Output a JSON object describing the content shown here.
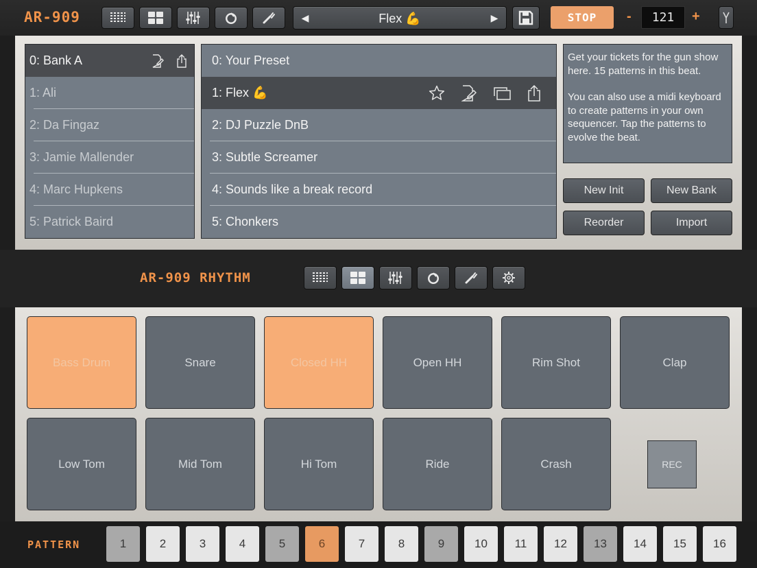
{
  "app": {
    "logo": "AR-909",
    "instrument_logo": "AR-909 RHYTHM",
    "accent_color": "#f0934a"
  },
  "toolbar": {
    "buttons": [
      {
        "icon": "grid-icon"
      },
      {
        "icon": "pads-icon"
      },
      {
        "icon": "mixer-icon"
      },
      {
        "icon": "knob-icon"
      },
      {
        "icon": "wrench-icon"
      }
    ],
    "preset_name": "Flex 💪",
    "prev_symbol": "◀",
    "next_symbol": "▶",
    "stop_label": "STOP",
    "tempo_minus": "-",
    "tempo_value": "121",
    "tempo_plus": "+"
  },
  "banks": [
    {
      "label": "0: Bank A",
      "selected": true
    },
    {
      "label": "1: Ali"
    },
    {
      "label": "2: Da Fingaz"
    },
    {
      "label": "3: Jamie Mallender"
    },
    {
      "label": "4: Marc Hupkens"
    },
    {
      "label": "5: Patrick Baird"
    }
  ],
  "presets": [
    {
      "label": "0: Your Preset"
    },
    {
      "label": "1: Flex 💪",
      "selected": true
    },
    {
      "label": "2: DJ Puzzle DnB"
    },
    {
      "label": "3: Subtle Screamer"
    },
    {
      "label": "4: Sounds like a break record"
    },
    {
      "label": "5: Chonkers"
    }
  ],
  "description": {
    "para1": "Get your tickets for the gun show here. 15 patterns in this beat.",
    "para2": "You can also use a midi keyboard to create patterns in your own sequencer. Tap the patterns to evolve the beat."
  },
  "actions": {
    "new_init": "New Init",
    "new_bank": "New Bank",
    "reorder": "Reorder",
    "import": "Import"
  },
  "pads": [
    {
      "label": "Bass Drum",
      "lit": true
    },
    {
      "label": "Snare"
    },
    {
      "label": "Closed HH",
      "lit": true
    },
    {
      "label": "Open HH"
    },
    {
      "label": "Rim Shot"
    },
    {
      "label": "Clap"
    },
    {
      "label": "Low Tom"
    },
    {
      "label": "Mid Tom"
    },
    {
      "label": "Hi Tom"
    },
    {
      "label": "Ride"
    },
    {
      "label": "Crash"
    }
  ],
  "rec_label": "REC",
  "pattern": {
    "label": "PATTERN",
    "buttons": [
      "1",
      "2",
      "3",
      "4",
      "5",
      "6",
      "7",
      "8",
      "9",
      "10",
      "11",
      "12",
      "13",
      "14",
      "15",
      "16"
    ],
    "active": "6",
    "dimmed": [
      "1",
      "5",
      "9",
      "13"
    ]
  }
}
